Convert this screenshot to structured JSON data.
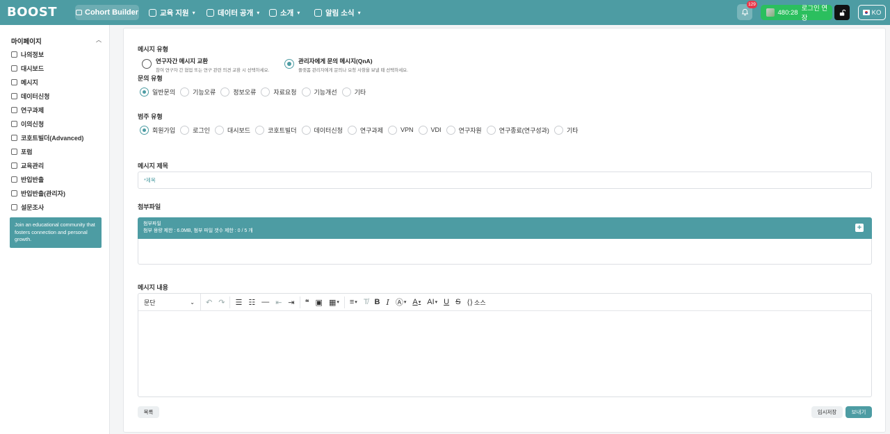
{
  "header": {
    "logo": "BOOST",
    "cohort_builder": "Cohort Builder",
    "nav": [
      "교육 지원",
      "데이터 공개",
      "소개",
      "알림 소식"
    ],
    "notification_count": "129",
    "session_time": "480:28",
    "session_action": "로그인 연장",
    "lang": "KO"
  },
  "sidebar": {
    "title": "마이페이지",
    "items": [
      "나의정보",
      "대시보드",
      "메시지",
      "데이터신청",
      "연구과제",
      "이의신청",
      "코호트빌더(Advanced)",
      "포럼",
      "교육관리",
      "반입반출",
      "반입반출(관리자)",
      "설문조사"
    ],
    "promo": "Join an educational community that fosters connection and personal growth."
  },
  "form": {
    "message_type_label": "메시지 유형",
    "message_types": [
      {
        "title": "연구자간 메시지 교환",
        "desc": "참여 연구자 간 협업 또는 연구 관련 의견 교환 시 선택하세요.",
        "checked": false
      },
      {
        "title": "관리자에게 문의 메시지(QnA)",
        "desc": "플랫폼 관리자에게 문의나 요청 사항을 보낼 때 선택하세요.",
        "checked": true
      }
    ],
    "inquiry_type_label": "문의 유형",
    "inquiry_types": [
      "일반문의",
      "기능오류",
      "정보오류",
      "자료요청",
      "기능개선",
      "기타"
    ],
    "category_label": "범주 유형",
    "categories": [
      "회원가입",
      "로그인",
      "대시보드",
      "코호트빌더",
      "데이터신청",
      "연구과제",
      "VPN",
      "VDI",
      "연구자원",
      "연구종료(연구성과)",
      "기타"
    ],
    "title_label": "메시지 제목",
    "title_placeholder": "*제목",
    "attach_label": "첨부파일",
    "attach_title": "첨부파일",
    "attach_limit": "첨부 용량 제한 : 6.0MB, 첨부 파일 갯수 제한 : 0 / 5 개",
    "content_label": "메시지 내용",
    "paragraph_select": "문단",
    "source_label": "소스",
    "btn_list": "목록",
    "btn_draft": "임시저장",
    "btn_send": "보내기"
  }
}
